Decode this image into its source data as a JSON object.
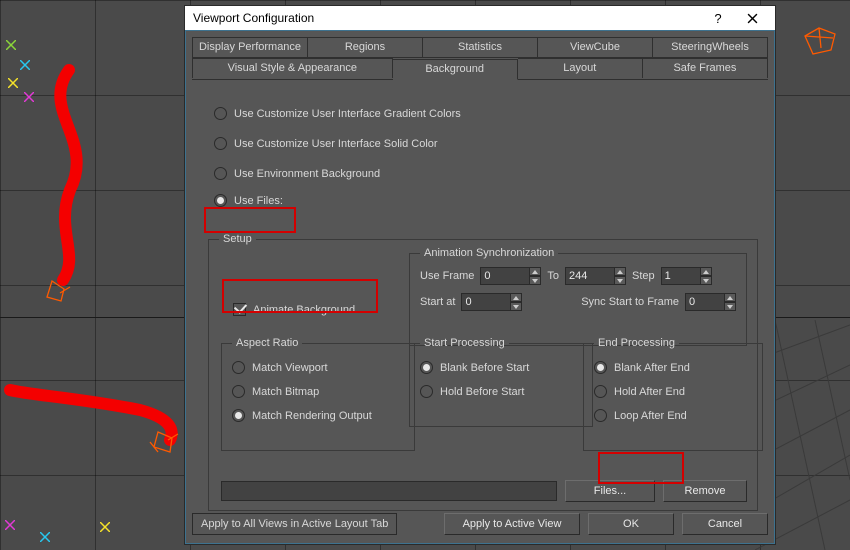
{
  "dialog": {
    "title": "Viewport Configuration",
    "tabs_row1": [
      "Display Performance",
      "Regions",
      "Statistics",
      "ViewCube",
      "SteeringWheels"
    ],
    "tabs_row2": [
      "Visual Style & Appearance",
      "Background",
      "Layout",
      "Safe Frames"
    ],
    "active_tab": "Background"
  },
  "bg_source": {
    "gradient": "Use Customize User Interface Gradient Colors",
    "solid": "Use Customize User Interface Solid Color",
    "env": "Use Environment Background",
    "files": "Use Files:"
  },
  "setup": {
    "legend": "Setup",
    "animate_bg": "Animate Background",
    "aspect": {
      "legend": "Aspect Ratio",
      "match_viewport": "Match Viewport",
      "match_bitmap": "Match Bitmap",
      "match_render": "Match Rendering Output"
    },
    "anim_sync": {
      "legend": "Animation Synchronization",
      "use_frame": "Use Frame",
      "to": "To",
      "step": "Step",
      "start_at": "Start at",
      "sync_start": "Sync Start to Frame",
      "val_use_frame": "0",
      "val_to": "244",
      "val_step": "1",
      "val_start_at": "0",
      "val_sync_start": "0"
    },
    "startp": {
      "legend": "Start Processing",
      "blank": "Blank Before Start",
      "hold": "Hold Before Start"
    },
    "endp": {
      "legend": "End Processing",
      "blank": "Blank After End",
      "hold": "Hold After End",
      "loop": "Loop After End"
    },
    "files_btn": "Files...",
    "remove_btn": "Remove"
  },
  "footer": {
    "apply_all": "Apply to All Views in Active Layout Tab",
    "apply_active": "Apply to Active View",
    "ok": "OK",
    "cancel": "Cancel"
  },
  "highlight_color": "#d40000"
}
